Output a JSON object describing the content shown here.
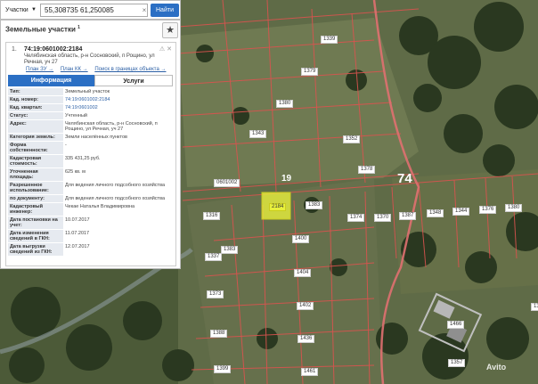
{
  "search": {
    "layer": "Участки",
    "query": "55,308735 61,250085",
    "clear": "×",
    "button": "Найти"
  },
  "panel": {
    "title": "Земельные участки",
    "count": "1",
    "star": "★"
  },
  "card": {
    "index": "1.",
    "cad_number": "74:19:0601002:2184",
    "address": "Челябинская область, р-н Сосновский, п Рощино, ул Речная, уч 27",
    "links": [
      "План ЗУ →",
      "План КК →",
      "Поиск в границах объекта →"
    ],
    "actions": "⚠ ✕"
  },
  "tabs": [
    "Информация",
    "Услуги"
  ],
  "info": [
    {
      "k": "Тип:",
      "v": "Земельный участок"
    },
    {
      "k": "Кад. номер:",
      "v": "74:19:0601002:2184"
    },
    {
      "k": "Кад. квартал:",
      "v": "74:19:0601002"
    },
    {
      "k": "Статус:",
      "v": "Учтенный"
    },
    {
      "k": "Адрес:",
      "v": "Челябинская область, р-н Сосновский, п Рощино, ул Речная, уч 27"
    },
    {
      "k": "Категория земель:",
      "v": "Земли населённых пунктов"
    },
    {
      "k": "Форма собственности:",
      "v": "-"
    },
    {
      "k": "Кадастровая стоимость:",
      "v": "335 431,25 руб."
    },
    {
      "k": "Уточненная площадь:",
      "v": "625 кв. м"
    },
    {
      "k": "Разрешенное использование:",
      "v": "Для ведения личного подсобного хозяйства"
    },
    {
      "k": "по документу:",
      "v": "Для ведения личного подсобного хозяйства"
    },
    {
      "k": "Кадастровый инженер:",
      "v": "Чекае Наталья Владимировна"
    },
    {
      "k": "Дата постановки на учет:",
      "v": "10.07.2017"
    },
    {
      "k": "Дата изменения сведений в ГКН:",
      "v": "11.07.2017"
    },
    {
      "k": "Дата выгрузки сведений из ГКН:",
      "v": "12.07.2017"
    }
  ],
  "map": {
    "parcel_labels": [
      "1339",
      "1379",
      "1380",
      "1343",
      "1352",
      "1378",
      "1374",
      "1370",
      "1387",
      "1348",
      "1344",
      "1376",
      "1380",
      "1316",
      "1383",
      "1337",
      "1400",
      "1383",
      "1404",
      "1373",
      "1402",
      "1388",
      "1436",
      "1399",
      "1461",
      "1466",
      "2184",
      "1357",
      "1360"
    ],
    "quarter_label": "0601002",
    "zone_labels": [
      "19",
      "74"
    ],
    "highlight_color": "#e8f03c",
    "boundary_color": "#e05a5a"
  },
  "watermark": "Avito"
}
